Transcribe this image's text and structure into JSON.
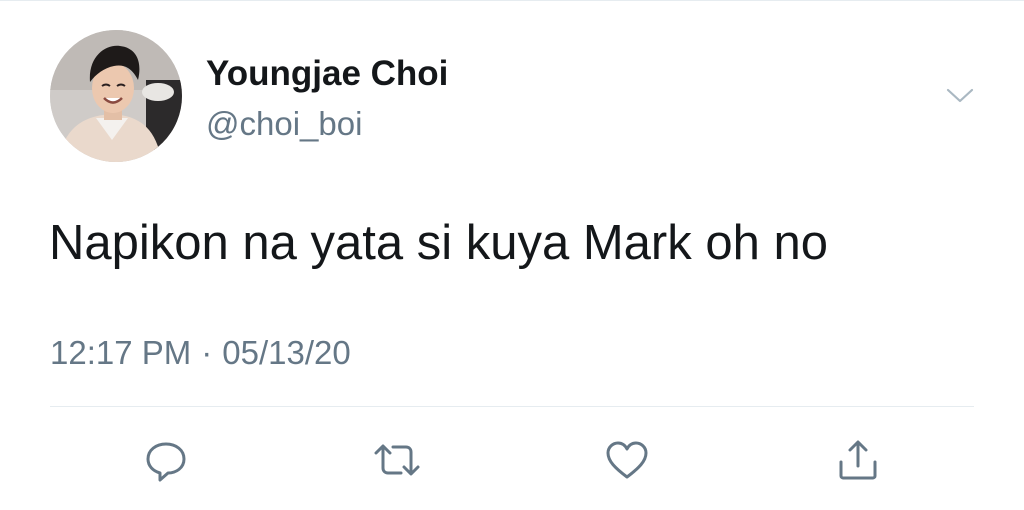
{
  "author": {
    "display_name": "Youngjae Choi",
    "handle": "@choi_boi",
    "avatar_icon": "profile-photo"
  },
  "tweet": {
    "text": "Napikon na yata si kuya Mark oh no",
    "time": "12:17 PM",
    "separator": "·",
    "date": "05/13/20"
  },
  "actions": {
    "reply_icon": "speech-bubble",
    "retweet_icon": "retweet-arrows",
    "like_icon": "heart",
    "share_icon": "share-upload"
  },
  "colors": {
    "text_primary": "#14171a",
    "text_secondary": "#657786",
    "icon": "#657786",
    "divider": "#e6ecf0"
  }
}
